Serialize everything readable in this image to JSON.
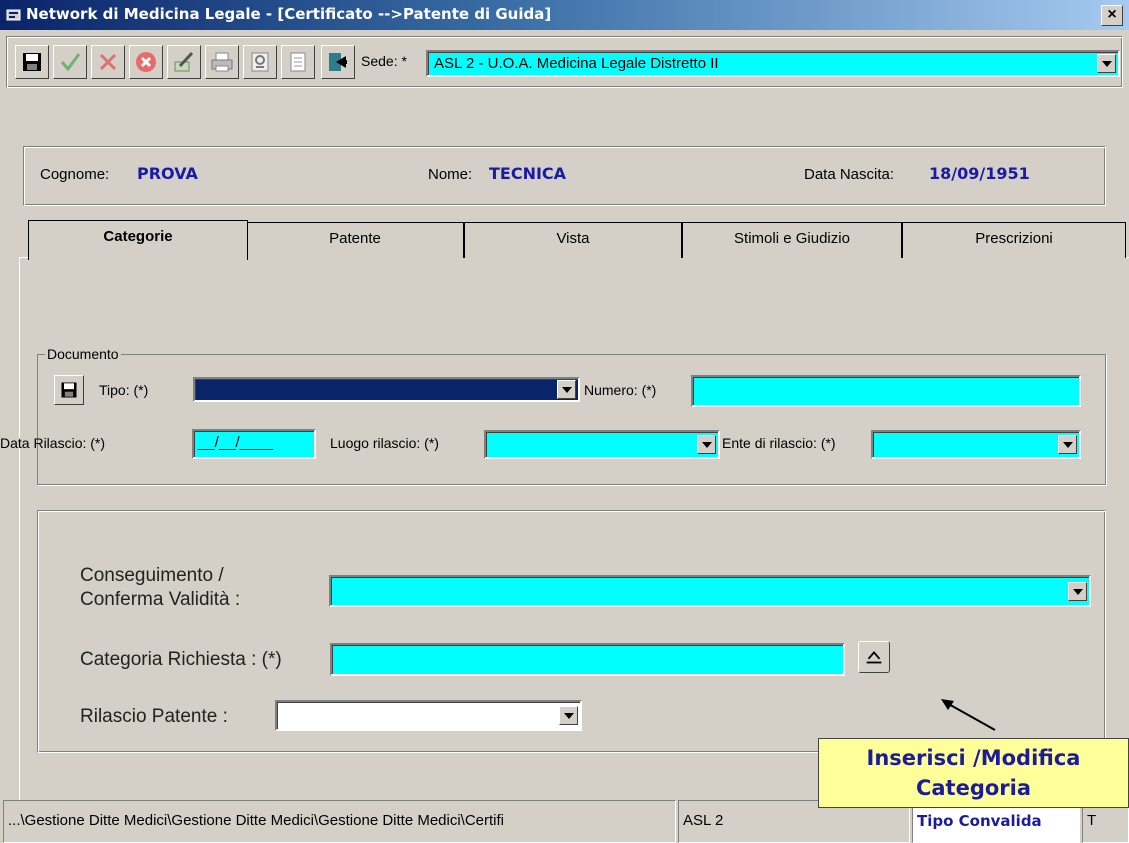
{
  "window": {
    "title": "Network di Medicina Legale - [Certificato -->Patente di Guida]",
    "close_label": "×"
  },
  "toolbar": {
    "buttons": [
      "save-icon",
      "confirm-icon",
      "cancel-icon",
      "delete-icon",
      "edit-icon",
      "print-icon",
      "certificate-icon",
      "document-icon",
      "exit-icon"
    ],
    "sede_label": "Sede: *",
    "sede_value": "ASL 2 - U.O.A. Medicina Legale Distretto II"
  },
  "patient": {
    "cognome_label": "Cognome:",
    "cognome_value": "PROVA",
    "nome_label": "Nome:",
    "nome_value": "TECNICA",
    "nascita_label": "Data Nascita:",
    "nascita_value": "18/09/1951"
  },
  "tabs": [
    "Categorie",
    "Patente",
    "Vista",
    "Stimoli e Giudizio",
    "Prescrizioni"
  ],
  "documento": {
    "legend": "Documento",
    "tipo_label": "Tipo: (*)",
    "numero_label": "Numero: (*)",
    "data_rilascio_label": "Data Rilascio: (*)",
    "data_rilascio_value": "__/__/____",
    "luogo_label": "Luogo rilascio: (*)",
    "ente_label": "Ente di rilascio: (*)"
  },
  "categoria": {
    "conseguimento_label_1": "Conseguimento /",
    "conseguimento_label_2": "Conferma Validità :",
    "richiesta_label": "Categoria Richiesta : (*)",
    "rilascio_label": "Rilascio Patente :"
  },
  "callout": {
    "line1": "Inserisci /Modifica",
    "line2": "Categoria"
  },
  "statusbar": {
    "path": "...\\Gestione Ditte Medici\\Gestione Ditte Medici\\Gestione Ditte Medici\\Certifi",
    "asl": "ASL 2",
    "tipo": "Tipo Convalida",
    "extra": "T"
  },
  "colors": {
    "field_cyan": "#00ffff",
    "value_blue": "#1a1aa8",
    "callout_bg": "#ffff99"
  }
}
